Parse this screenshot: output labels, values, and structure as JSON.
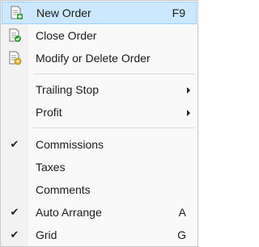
{
  "menu": {
    "items": [
      {
        "label": "New Order",
        "shortcut": "F9",
        "icon": "new-order-icon"
      },
      {
        "label": "Close Order",
        "icon": "close-order-icon"
      },
      {
        "label": "Modify or Delete Order",
        "icon": "modify-order-icon"
      },
      {
        "label": "Trailing Stop",
        "submenu": true
      },
      {
        "label": "Profit",
        "submenu": true
      },
      {
        "label": "Commissions",
        "checked": true
      },
      {
        "label": "Taxes",
        "checked": false
      },
      {
        "label": "Comments",
        "checked": false
      },
      {
        "label": "Auto Arrange",
        "shortcut": "A",
        "checked": true
      },
      {
        "label": "Grid",
        "shortcut": "G",
        "checked": true
      }
    ],
    "check_glyph": "✔",
    "colors": {
      "highlight": "#cce8ff",
      "highlight_border": "#99d1ff",
      "green": "#2e9e3a",
      "yellow": "#e3b42a"
    }
  }
}
